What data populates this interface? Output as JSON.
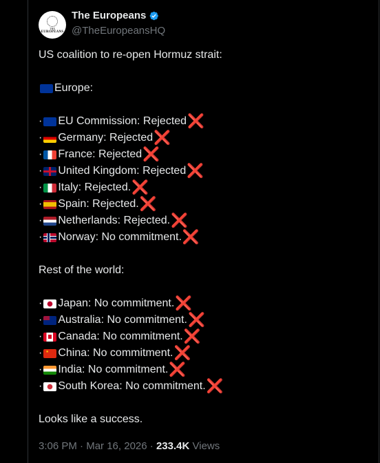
{
  "author": {
    "name": "The Europeans",
    "handle": "@TheEuropeansHQ",
    "avatar_text_top": "THE",
    "avatar_text_bottom": "EUROPEANS"
  },
  "post": {
    "title": "US coalition to re-open Hormuz strait:",
    "europe_heading": "Europe:",
    "europe": [
      {
        "flag": "eu",
        "text": "EU Commission: Rejected"
      },
      {
        "flag": "de",
        "text": "Germany: Rejected"
      },
      {
        "flag": "fr",
        "text": "France: Rejected"
      },
      {
        "flag": "uk",
        "text": "United Kingdom: Rejected"
      },
      {
        "flag": "it",
        "text": "Italy: Rejected."
      },
      {
        "flag": "es",
        "text": "Spain: Rejected."
      },
      {
        "flag": "nl",
        "text": "Netherlands: Rejected."
      },
      {
        "flag": "no",
        "text": "Norway: No commitment."
      }
    ],
    "rest_heading": "Rest of the world:",
    "rest": [
      {
        "flag": "jp",
        "text": "Japan: No commitment."
      },
      {
        "flag": "au",
        "text": "Australia: No commitment."
      },
      {
        "flag": "ca",
        "text": "Canada: No commitment."
      },
      {
        "flag": "cn",
        "text": "China: No commitment."
      },
      {
        "flag": "in",
        "text": "India: No commitment."
      },
      {
        "flag": "kr",
        "text": "South Korea: No commitment."
      }
    ],
    "bullet": "·",
    "cross": "❌",
    "closing": "Looks like a success."
  },
  "meta": {
    "time": "3:06 PM",
    "separator": "·",
    "date": "Mar 16, 2026",
    "views_count": "233.4K",
    "views_label": "Views"
  }
}
